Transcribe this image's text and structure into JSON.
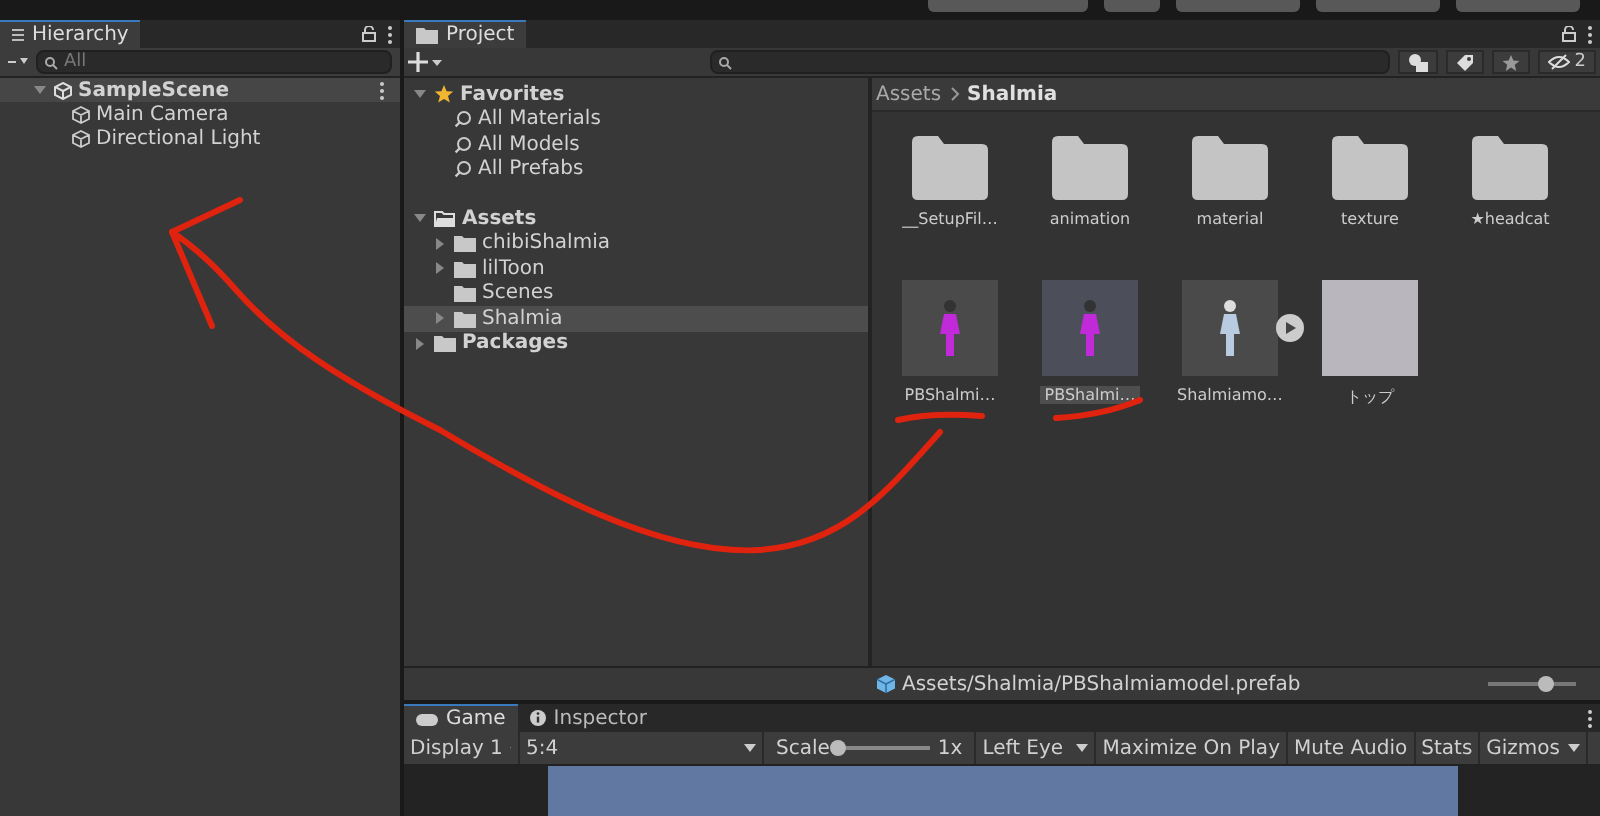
{
  "hierarchy": {
    "title": "Hierarchy",
    "search": {
      "placeholder": "All"
    },
    "scene": {
      "name": "SampleScene",
      "expanded": true
    },
    "objects": [
      "Main Camera",
      "Directional Light"
    ]
  },
  "project": {
    "title": "Project",
    "hidden_count": "2",
    "tree": [
      {
        "label": "Favorites",
        "kind": "favorites",
        "expanded": true,
        "selected": false,
        "children": [
          {
            "label": "All Materials",
            "kind": "search",
            "selected": false
          },
          {
            "label": "All Models",
            "kind": "search",
            "selected": false
          },
          {
            "label": "All Prefabs",
            "kind": "search",
            "selected": false
          }
        ]
      },
      {
        "label": "Assets",
        "kind": "folder",
        "expanded": true,
        "selected": false,
        "children": [
          {
            "label": "chibiShalmia",
            "kind": "folder",
            "expanded": false,
            "selected": false
          },
          {
            "label": "lilToon",
            "kind": "folder",
            "expanded": false,
            "selected": false
          },
          {
            "label": "Scenes",
            "kind": "folder",
            "selected": false
          },
          {
            "label": "Shalmia",
            "kind": "folder",
            "expanded": false,
            "selected": true
          }
        ]
      },
      {
        "label": "Packages",
        "kind": "folder",
        "expanded": false,
        "selected": false
      }
    ],
    "breadcrumb": [
      "Assets",
      "Shalmia"
    ],
    "assets": [
      {
        "label": "__SetupFil…",
        "kind": "folder",
        "selected": false
      },
      {
        "label": "animation",
        "kind": "folder",
        "selected": false
      },
      {
        "label": "material",
        "kind": "folder",
        "selected": false
      },
      {
        "label": "texture",
        "kind": "folder",
        "selected": false
      },
      {
        "label": "★headcat",
        "kind": "folder",
        "selected": false
      },
      {
        "label": "PBShalmi…",
        "kind": "prefab",
        "selected": false
      },
      {
        "label": "PBShalmi…",
        "kind": "prefab",
        "selected": true
      },
      {
        "label": "Shalmiamo…",
        "kind": "model",
        "selected": false
      },
      {
        "label": "トップ",
        "kind": "image",
        "selected": false
      }
    ],
    "path": "Assets/Shalmia/PBShalmiamodel.prefab",
    "zoom": {
      "level": 0.65
    }
  },
  "game": {
    "tabs": [
      {
        "label": "Game",
        "kind": "game",
        "selected": true
      },
      {
        "label": "Inspector",
        "kind": "info",
        "selected": false
      }
    ],
    "display": "Display 1",
    "aspect": "5:4",
    "scale_label": "Scale",
    "scale": {
      "level": 0.0
    },
    "scale_value": "1x",
    "eye": "Left Eye",
    "buttons": [
      "Maximize On Play",
      "Mute Audio",
      "Stats"
    ],
    "gizmos": "Gizmos"
  }
}
